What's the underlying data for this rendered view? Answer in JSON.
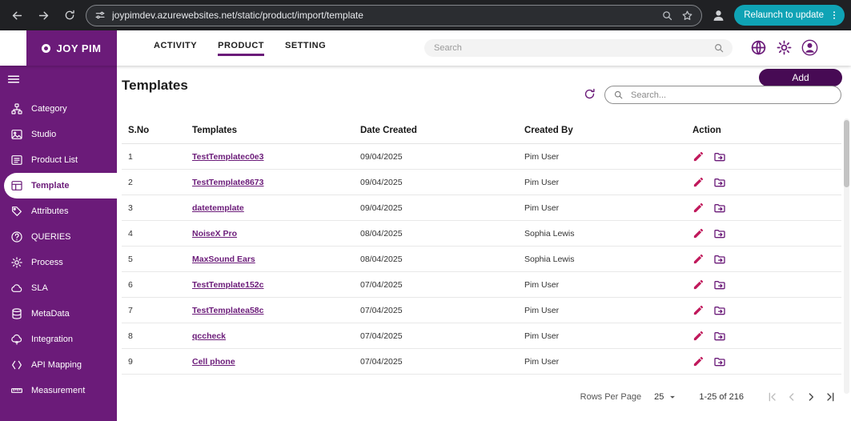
{
  "browser": {
    "url": "joypimdev.azurewebsites.net/static/product/import/template",
    "relaunch_button": "Relaunch to update"
  },
  "header": {
    "brand": "JOY PIM",
    "nav": [
      {
        "label": "ACTIVITY",
        "active": false
      },
      {
        "label": "PRODUCT",
        "active": true
      },
      {
        "label": "SETTING",
        "active": false
      }
    ],
    "search_placeholder": "Search",
    "icons": [
      "globe-icon",
      "settings-gear-icon",
      "account-icon"
    ]
  },
  "sidebar": {
    "items": [
      {
        "label": "Category",
        "icon": "category-icon",
        "active": false
      },
      {
        "label": "Studio",
        "icon": "studio-icon",
        "active": false
      },
      {
        "label": "Product List",
        "icon": "product-list-icon",
        "active": false
      },
      {
        "label": "Template",
        "icon": "template-icon",
        "active": true
      },
      {
        "label": "Attributes",
        "icon": "attributes-icon",
        "active": false
      },
      {
        "label": "QUERIES",
        "icon": "queries-icon",
        "active": false
      },
      {
        "label": "Process",
        "icon": "process-icon",
        "active": false
      },
      {
        "label": "SLA",
        "icon": "sla-icon",
        "active": false
      },
      {
        "label": "MetaData",
        "icon": "metadata-icon",
        "active": false
      },
      {
        "label": "Integration",
        "icon": "integration-icon",
        "active": false
      },
      {
        "label": "API Mapping",
        "icon": "api-mapping-icon",
        "active": false
      },
      {
        "label": "Measurement",
        "icon": "measurement-icon",
        "active": false
      }
    ]
  },
  "main": {
    "title": "Templates",
    "add_button": "Add",
    "search_placeholder": "Search...",
    "table": {
      "headers": [
        "S.No",
        "Templates",
        "Date Created",
        "Created By",
        "Action"
      ],
      "action_icons": [
        "edit-icon",
        "copy-icon"
      ],
      "rows": [
        {
          "sno": "1",
          "template": "TestTemplatec0e3",
          "date": "09/04/2025",
          "created_by": "Pim User"
        },
        {
          "sno": "2",
          "template": "TestTemplate8673",
          "date": "09/04/2025",
          "created_by": "Pim User"
        },
        {
          "sno": "3",
          "template": "datetemplate",
          "date": "09/04/2025",
          "created_by": "Pim User"
        },
        {
          "sno": "4",
          "template": "NoiseX Pro",
          "date": "08/04/2025",
          "created_by": "Sophia Lewis"
        },
        {
          "sno": "5",
          "template": "MaxSound Ears",
          "date": "08/04/2025",
          "created_by": "Sophia Lewis"
        },
        {
          "sno": "6",
          "template": "TestTemplate152c",
          "date": "07/04/2025",
          "created_by": "Pim User"
        },
        {
          "sno": "7",
          "template": "TestTemplatea58c",
          "date": "07/04/2025",
          "created_by": "Pim User"
        },
        {
          "sno": "8",
          "template": "qccheck",
          "date": "07/04/2025",
          "created_by": "Pim User"
        },
        {
          "sno": "9",
          "template": "Cell phone",
          "date": "07/04/2025",
          "created_by": "Pim User"
        }
      ]
    },
    "pagination": {
      "rows_per_page_label": "Rows Per Page",
      "rows_per_page_value": "25",
      "range_label": "1-25 of 216"
    }
  },
  "colors": {
    "brand_purple": "#6B1B79",
    "dark_purple_button": "#470A54",
    "edit_icon_pink": "#C0185B",
    "relaunch_teal": "#0FA3B5",
    "toolbar_dark": "#202124"
  }
}
